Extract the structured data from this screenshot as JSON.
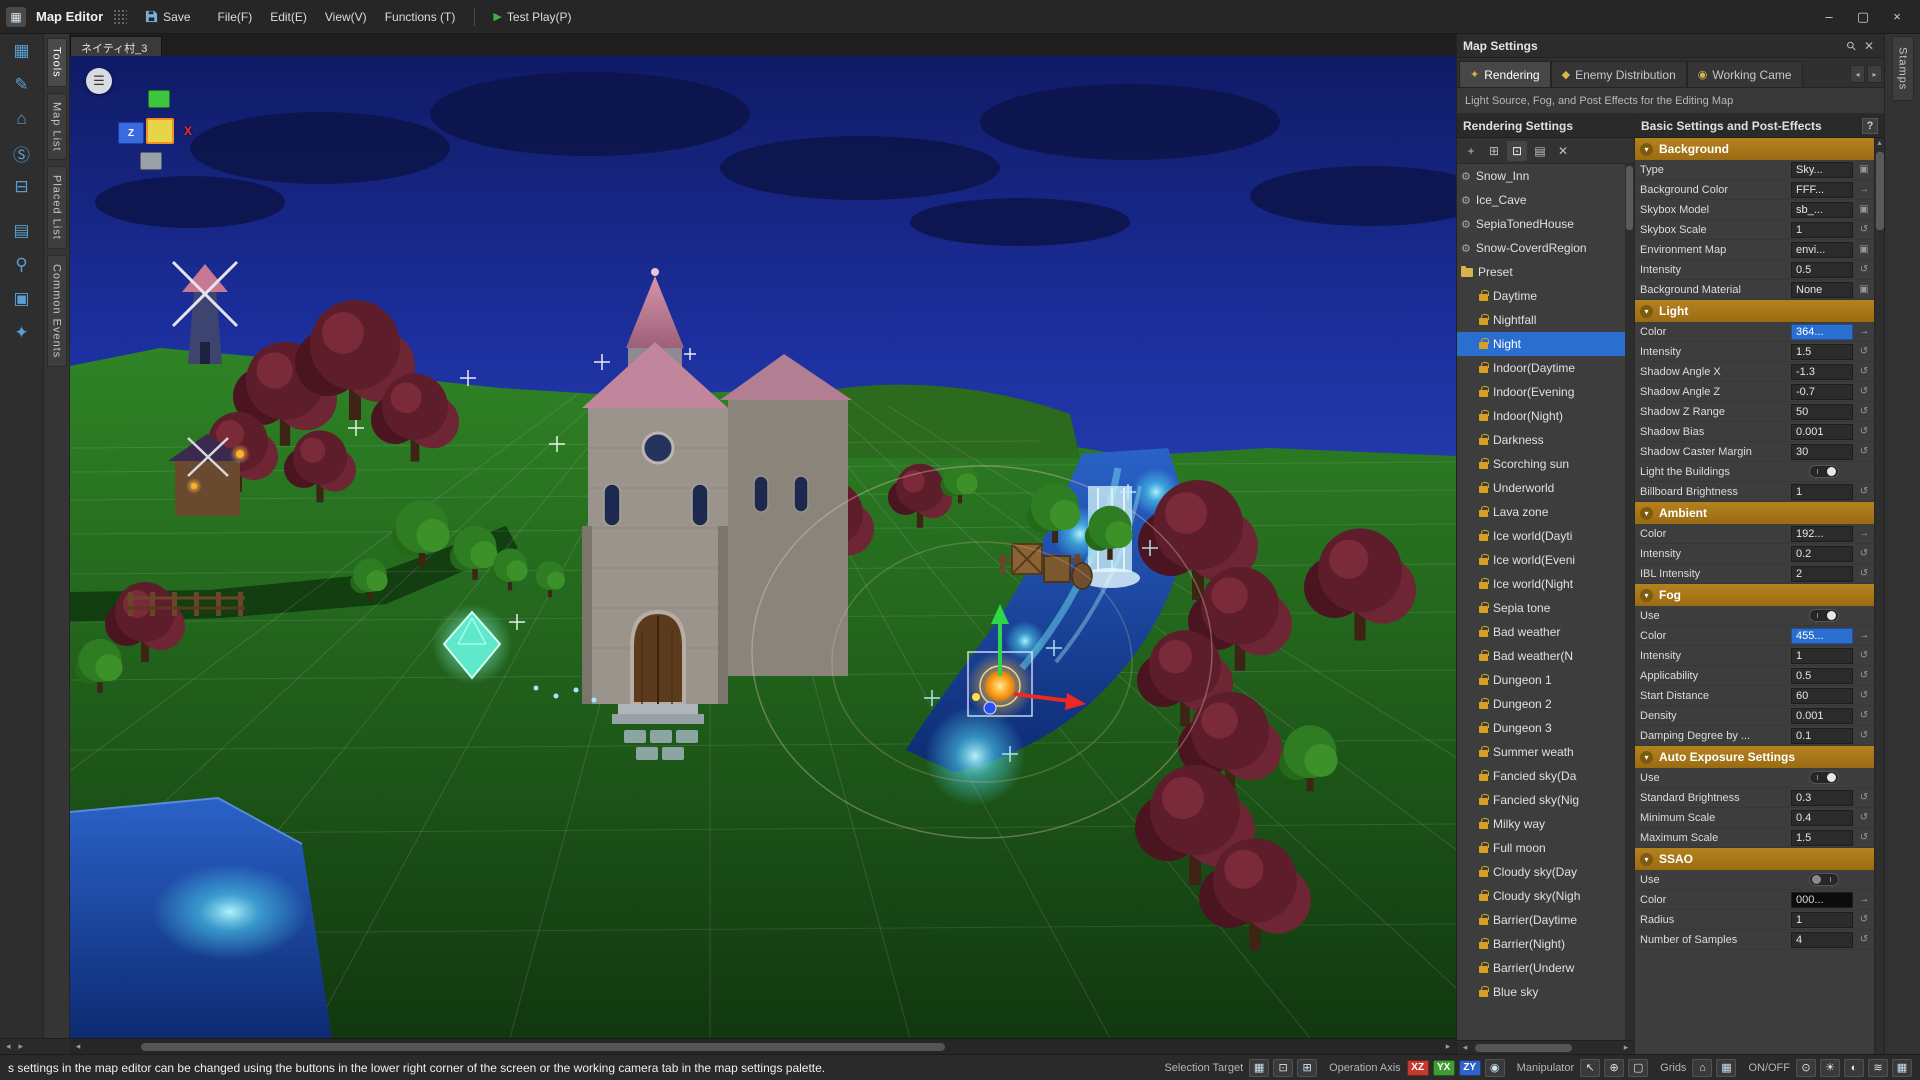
{
  "window": {
    "title": "Map Editor",
    "app_icon_glyph": "▦",
    "controls": {
      "minimize": "–",
      "maximize": "▢",
      "close": "×"
    }
  },
  "menu_bar": {
    "save": "Save",
    "menus": [
      "File(F)",
      "Edit(E)",
      "View(V)",
      "Functions (T)"
    ],
    "test_play": "Test Play(P)"
  },
  "left_toolbar": {
    "tools": [
      {
        "name": "map-mode-tool-icon",
        "glyph": "▦"
      },
      {
        "name": "edit-tool-icon",
        "glyph": "✎"
      },
      {
        "name": "building-tool-icon",
        "glyph": "⌂"
      },
      {
        "name": "event-tool-icon",
        "glyph": "Ⓢ"
      },
      {
        "name": "object-tool-icon",
        "glyph": "⊟"
      },
      {
        "name": "display-tool-icon",
        "glyph": "▤"
      },
      {
        "name": "search-tool-icon",
        "glyph": "⚲"
      },
      {
        "name": "layers-tool-icon",
        "glyph": "▣"
      },
      {
        "name": "stamp-tool-icon",
        "glyph": "✦"
      }
    ]
  },
  "left_tabs": [
    "Tools",
    "Map List",
    "Placed List",
    "Common Events"
  ],
  "stamps_label": "Stamps",
  "viewport": {
    "map_tab": "ネイティ村_3",
    "gizmo_z": "Z",
    "gizmo_x": "X",
    "hamburger_glyph": "☰"
  },
  "map_settings": {
    "title": "Map Settings",
    "tabs": [
      {
        "label": "Rendering",
        "icon_name": "rendering-tab-icon",
        "icon": "✦",
        "selected": true
      },
      {
        "label": "Enemy Distribution",
        "icon_name": "enemy-distribution-tab-icon",
        "icon": "◆",
        "selected": false
      },
      {
        "label": "Working Came",
        "icon_name": "working-camera-tab-icon",
        "icon": "◉",
        "selected": false
      }
    ],
    "description": "Light Source, Fog, and Post Effects for the Editing Map",
    "rendering_settings": {
      "title": "Rendering Settings",
      "toolbar": [
        {
          "name": "add-item-icon",
          "glyph": "+"
        },
        {
          "name": "add-folder-icon",
          "glyph": "⊞"
        },
        {
          "name": "duplicate-item-icon",
          "glyph": "⊡",
          "lit": true
        },
        {
          "name": "paste-item-icon",
          "glyph": "▤"
        },
        {
          "name": "delete-item-icon",
          "glyph": "✕"
        }
      ],
      "custom_items": [
        "Snow_Inn",
        "Ice_Cave",
        "SepiaTonedHouse",
        "Snow-CoverdRegion"
      ],
      "folder_label": "Preset",
      "preset_items": [
        "Daytime",
        "Nightfall",
        "Night",
        "Indoor(Daytime",
        "Indoor(Evening",
        "Indoor(Night)",
        "Darkness",
        "Scorching sun",
        "Underworld",
        "Lava zone",
        "Ice world(Dayti",
        "Ice world(Eveni",
        "Ice world(Night",
        "Sepia tone",
        "Bad weather",
        "Bad weather(N",
        "Dungeon 1",
        "Dungeon 2",
        "Dungeon 3",
        "Summer weath",
        "Fancied sky(Da",
        "Fancied sky(Nig",
        "Milky way",
        "Full moon",
        "Cloudy sky(Day",
        "Cloudy sky(Nigh",
        "Barrier(Daytime",
        "Barrier(Night)",
        "Barrier(Underw",
        "Blue sky"
      ],
      "selected_item": "Night"
    },
    "properties_panel": {
      "title": "Basic Settings and Post-Effects",
      "help_label": "?",
      "sections": [
        {
          "title": "Background",
          "rows": [
            {
              "label": "Type",
              "value": "Sky...",
              "type": "picker"
            },
            {
              "label": "Background Color",
              "value": "FFF...",
              "type": "color",
              "variant": "default"
            },
            {
              "label": "Skybox Model",
              "value": "sb_...",
              "type": "picker"
            },
            {
              "label": "Skybox Scale",
              "value": "1",
              "type": "number"
            },
            {
              "label": "Environment Map",
              "value": "envi...",
              "type": "picker"
            },
            {
              "label": "Intensity",
              "value": "0.5",
              "type": "number"
            },
            {
              "label": "Background Material",
              "value": "None",
              "type": "picker"
            }
          ]
        },
        {
          "title": "Light",
          "rows": [
            {
              "label": "Color",
              "value": "364...",
              "type": "color",
              "variant": "active"
            },
            {
              "label": "Intensity",
              "value": "1.5",
              "type": "number"
            },
            {
              "label": "Shadow Angle X",
              "value": "-1.3",
              "type": "number"
            },
            {
              "label": "Shadow Angle Z",
              "value": "-0.7",
              "type": "number"
            },
            {
              "label": "Shadow Z Range",
              "value": "50",
              "type": "number"
            },
            {
              "label": "Shadow Bias",
              "value": "0.001",
              "type": "number"
            },
            {
              "label": "Shadow Caster Margin",
              "value": "30",
              "type": "number"
            },
            {
              "label": "Light the Buildings",
              "type": "toggle",
              "on": true
            },
            {
              "label": "Billboard Brightness",
              "value": "1",
              "type": "number"
            }
          ]
        },
        {
          "title": "Ambient",
          "rows": [
            {
              "label": "Color",
              "value": "192...",
              "type": "color",
              "variant": "default"
            },
            {
              "label": "Intensity",
              "value": "0.2",
              "type": "number"
            },
            {
              "label": "IBL Intensity",
              "value": "2",
              "type": "number"
            }
          ]
        },
        {
          "title": "Fog",
          "rows": [
            {
              "label": "Use",
              "type": "toggle",
              "on": true
            },
            {
              "label": "Color",
              "value": "455...",
              "type": "color",
              "variant": "active"
            },
            {
              "label": "Intensity",
              "value": "1",
              "type": "number"
            },
            {
              "label": "Applicability",
              "value": "0.5",
              "type": "number"
            },
            {
              "label": "Start Distance",
              "value": "60",
              "type": "number"
            },
            {
              "label": "Density",
              "value": "0.001",
              "type": "number"
            },
            {
              "label": "Damping Degree by ...",
              "value": "0.1",
              "type": "number"
            }
          ]
        },
        {
          "title": "Auto Exposure Settings",
          "rows": [
            {
              "label": "Use",
              "type": "toggle",
              "on": true
            },
            {
              "label": "Standard Brightness",
              "value": "0.3",
              "type": "number"
            },
            {
              "label": "Minimum Scale",
              "value": "0.4",
              "type": "number"
            },
            {
              "label": "Maximum Scale",
              "value": "1.5",
              "type": "number"
            }
          ]
        },
        {
          "title": "SSAO",
          "rows": [
            {
              "label": "Use",
              "type": "toggle",
              "on": false
            },
            {
              "label": "Color",
              "value": "000...",
              "type": "color",
              "variant": "black"
            },
            {
              "label": "Radius",
              "value": "1",
              "type": "number"
            },
            {
              "label": "Number of Samples",
              "value": "4",
              "type": "number"
            }
          ]
        }
      ]
    }
  },
  "status_bar": {
    "hint": "s settings in the map editor can be changed using the buttons in the lower right corner of the screen or the working camera tab in the map settings palette.",
    "groups": [
      {
        "label": "Selection Target",
        "icons": [
          {
            "name": "tile-target-icon",
            "glyph": "▦"
          },
          {
            "name": "object-target-icon",
            "glyph": "⊡"
          },
          {
            "name": "event-target-icon",
            "glyph": "⊞"
          }
        ]
      },
      {
        "label": "Operation Axis",
        "axis": [
          {
            "label": "XZ",
            "color": "#c23b2e"
          },
          {
            "label": "YX",
            "color": "#3f9b35"
          },
          {
            "label": "ZY",
            "color": "#2f63c9"
          }
        ],
        "icons": [
          {
            "name": "camera-axis-icon",
            "glyph": "◉"
          }
        ]
      },
      {
        "label": "Manipulator",
        "icons": [
          {
            "name": "select-manipulator-icon",
            "glyph": "↖"
          },
          {
            "name": "move-manipulator-icon",
            "glyph": "⊕"
          },
          {
            "name": "scale-manipulator-icon",
            "glyph": "▢"
          }
        ]
      },
      {
        "label": "Grids",
        "icons": [
          {
            "name": "building-grid-icon",
            "glyph": "⌂"
          },
          {
            "name": "tile-grid-icon",
            "glyph": "▦"
          }
        ]
      },
      {
        "label": "ON/OFF",
        "icons": [
          {
            "name": "lightbulb-icon",
            "glyph": "⊙"
          },
          {
            "name": "sun-icon",
            "glyph": "☀"
          },
          {
            "name": "shadow-icon",
            "glyph": "◐"
          },
          {
            "name": "fog-icon",
            "glyph": "≋"
          },
          {
            "name": "grid-visibility-icon",
            "glyph": "▦"
          }
        ]
      }
    ]
  }
}
